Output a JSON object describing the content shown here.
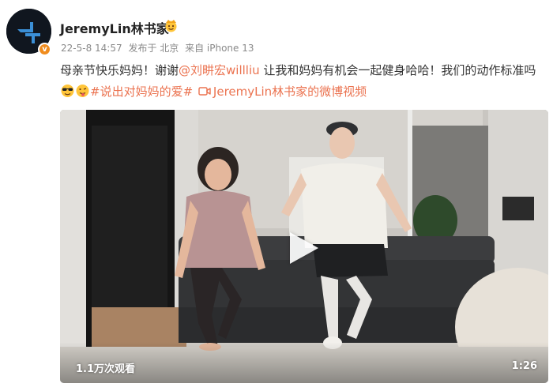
{
  "post": {
    "username": "JeremyLin林书家",
    "avatar_badge": "v",
    "meta": {
      "timestamp": "22-5-8 14:57",
      "location": "发布于 北京",
      "source": "来自 iPhone 13"
    },
    "text": {
      "part1": "母亲节快乐妈妈！谢谢",
      "mention": "@刘畊宏willliu",
      "part2": " 让我和妈妈有机会一起健身哈哈！我们的动作标准吗",
      "hashtag": "#说出对妈妈的爱#",
      "video_link": "JeremyLin林书家的微博视频"
    },
    "video": {
      "view_count": "1.1万次观看",
      "duration": "1:26"
    }
  },
  "colors": {
    "link": "#eb7350",
    "badge": "#f08c1e",
    "meta": "#8a8a8a"
  },
  "icons": [
    "avatar-logo-icon",
    "verified-badge-icon",
    "crown-emoji-icon",
    "sunglasses-emoji-icon",
    "tongue-emoji-icon",
    "video-link-icon",
    "play-icon"
  ]
}
